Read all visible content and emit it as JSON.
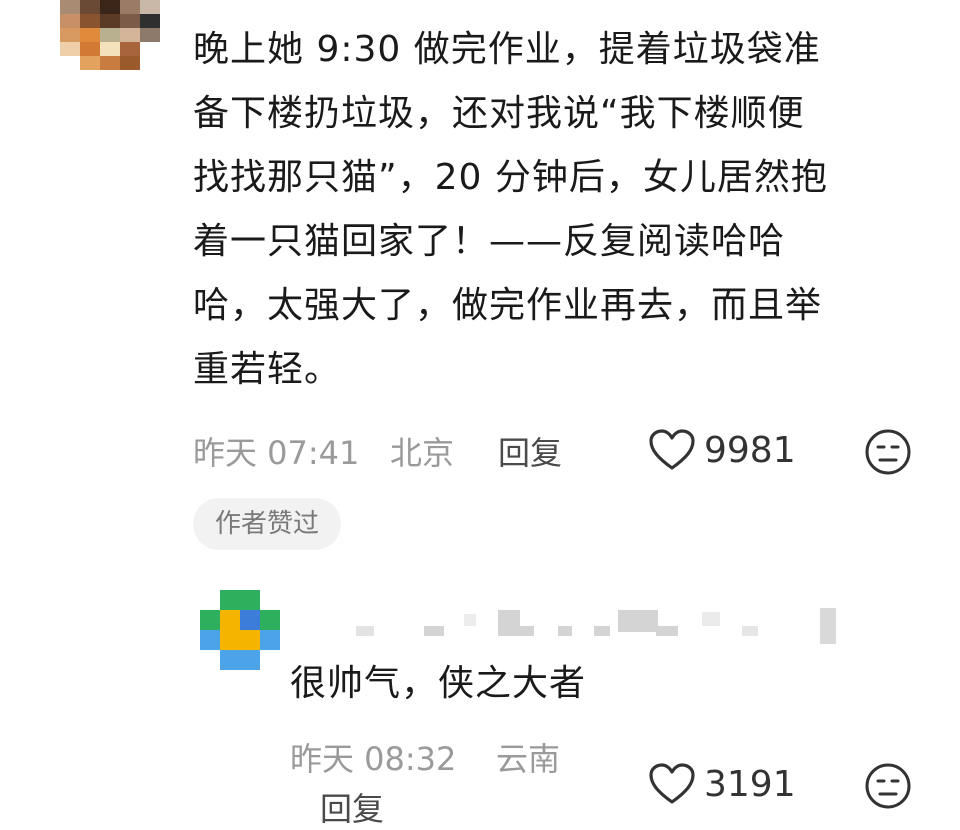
{
  "comment": {
    "text": "晚上她 9:30 做完作业，提着垃圾袋准备下楼扔垃圾，还对我说“我下楼顺便找找那只猫”，20 分钟后，女儿居然抱着一只猫回家了！——反复阅读哈哈哈，太强大了，做完作业再去，而且举重若轻。",
    "lines": [
      "晚上她 9:30 做完作业，提着垃圾袋准",
      "备下楼扔垃圾，还对我说“我下楼顺便",
      "找找那只猫”，20 分钟后，女儿居然抱",
      "着一只猫回家了！——反复阅读哈哈",
      "哈，太强大了，做完作业再去，而且举",
      "重若轻。"
    ],
    "time": "昨天 07:41",
    "location": "北京",
    "reply_label": "回复",
    "like_count": "9981",
    "author_badge": "作者赞过",
    "icons": {
      "like": "heart-outline-icon",
      "emoji": "meh-face-icon"
    }
  },
  "reply": {
    "text": "很帅气，侠之大者",
    "time": "昨天 08:32",
    "location": "云南",
    "reply_label": "回复",
    "like_count": "3191"
  },
  "colors": {
    "text": "#1a1a1a",
    "meta": "#9a9a9a",
    "badge_bg": "#f2f2f2",
    "badge_text": "#7a7a7a"
  }
}
